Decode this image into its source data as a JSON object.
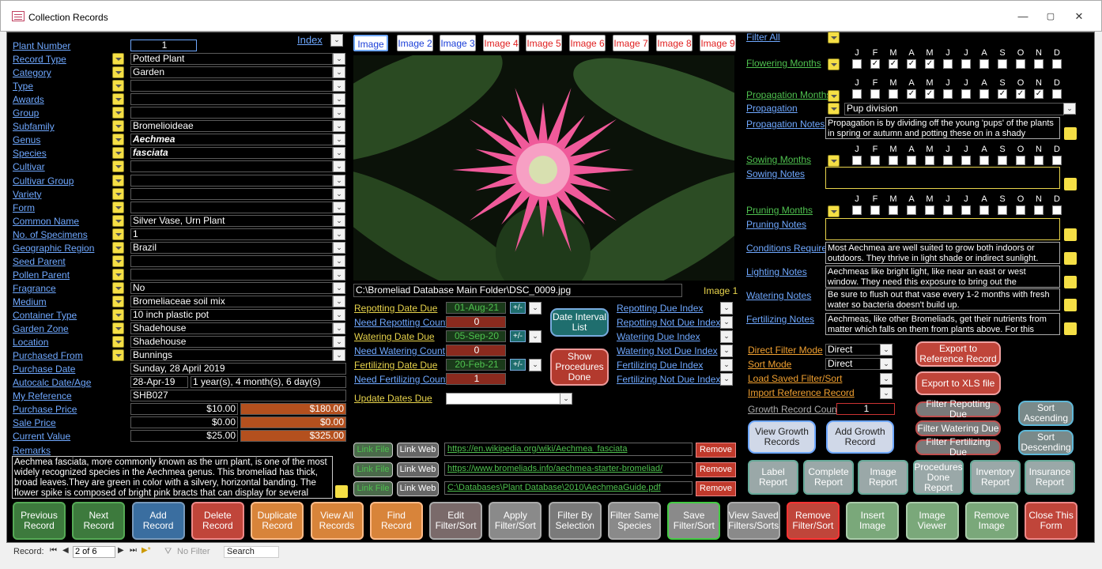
{
  "window": {
    "title": "Collection Records",
    "min": "—",
    "max": "▢",
    "close": "✕"
  },
  "index_label": "Index",
  "fields": [
    {
      "label": "Plant Number",
      "value": "1",
      "kind": "num"
    },
    {
      "label": "Record Type",
      "value": "Potted Plant"
    },
    {
      "label": "Category",
      "value": "Garden"
    },
    {
      "label": "Type",
      "value": ""
    },
    {
      "label": "Awards",
      "value": ""
    },
    {
      "label": "Group",
      "value": ""
    },
    {
      "label": "Subfamily",
      "value": "Bromelioideae"
    },
    {
      "label": "Genus",
      "value": "Aechmea",
      "italic": true
    },
    {
      "label": "Species",
      "value": "fasciata",
      "italic": true
    },
    {
      "label": "Cultivar",
      "value": ""
    },
    {
      "label": "Cultivar Group",
      "value": ""
    },
    {
      "label": "Variety",
      "value": ""
    },
    {
      "label": "Form",
      "value": ""
    },
    {
      "label": "Common Name",
      "value": "Silver Vase, Urn Plant"
    },
    {
      "label": "No. of Specimens",
      "value": "1"
    },
    {
      "label": "Geographic Region",
      "value": "Brazil"
    },
    {
      "label": "Seed Parent",
      "value": ""
    },
    {
      "label": "Pollen Parent",
      "value": ""
    },
    {
      "label": "Fragrance",
      "value": "No"
    },
    {
      "label": "Medium",
      "value": "Bromeliaceae soil mix"
    },
    {
      "label": "Container Type",
      "value": "10 inch plastic pot"
    },
    {
      "label": "Garden Zone",
      "value": "Shadehouse"
    },
    {
      "label": "Location",
      "value": "Shadehouse"
    },
    {
      "label": "Purchased From",
      "value": "Bunnings"
    }
  ],
  "purchase_date": {
    "label": "Purchase Date",
    "value": "Sunday, 28 April 2019"
  },
  "autocalc": {
    "label": "Autocalc Date/Age",
    "date": "28-Apr-19",
    "age": "1 year(s), 4 month(s), 6 day(s)"
  },
  "my_reference": {
    "label": "My Reference",
    "value": "SHB027"
  },
  "prices": [
    {
      "label": "Purchase Price",
      "value": "$10.00",
      "total": "$180.00"
    },
    {
      "label": "Sale Price",
      "value": "$0.00",
      "total": "$0.00"
    },
    {
      "label": "Current Value",
      "value": "$25.00",
      "total": "$325.00"
    }
  ],
  "remarks": {
    "label": "Remarks",
    "text": "Aechmea fasciata, more commonly known as the urn plant, is one of the most widely recognized species in the Aechmea genus. This bromeliad has thick, broad leaves.They are green in color with a silvery, horizontal banding. The flower spike is composed of bright pink bracts that can display for several"
  },
  "image_tabs": [
    "Image 1",
    "Image 2",
    "Image 3",
    "Image 4",
    "Image 5",
    "Image 6",
    "Image 7",
    "Image 8",
    "Image 9"
  ],
  "image_path": "C:\\Bromeliad Database Main Folder\\DSC_0009.jpg",
  "image_caption": "Image 1",
  "dates": [
    {
      "label": "Repotting Date Due",
      "value": "01-Aug-21",
      "count_label": "Need Repotting Count",
      "count": "0"
    },
    {
      "label": "Watering Date Due",
      "value": "05-Sep-20",
      "count_label": "Need Watering Count",
      "count": "0"
    },
    {
      "label": "Fertilizing Date Due",
      "value": "20-Feb-21",
      "count_label": "Need Fertilizing Count",
      "count": "1"
    }
  ],
  "plusminus": "+/-",
  "date_interval_btn": "Date Interval List",
  "show_procedures_btn": "Show Procedures Done",
  "index_links": [
    "Repotting Due Index",
    "Repotting Not Due Index",
    "Watering Due Index",
    "Watering Not Due Index",
    "Fertilizing Due Index",
    "Fertilizing Not Due Index"
  ],
  "update_dates": {
    "label": "Update Dates Due",
    "value": ""
  },
  "links": [
    {
      "file": "Link File",
      "web": "Link Web",
      "url": "https://en.wikipedia.org/wiki/Aechmea_fasciata",
      "remove": "Remove"
    },
    {
      "file": "Link File",
      "web": "Link Web",
      "url": "https://www.bromeliads.info/aechmea-starter-bromeliad/",
      "remove": "Remove"
    },
    {
      "file": "Link File",
      "web": "Link Web",
      "url": "C:\\Databases\\Plant Database\\2010\\AechmeaGuide.pdf",
      "remove": "Remove"
    }
  ],
  "filter_all": "Filter All",
  "months": [
    "J",
    "F",
    "M",
    "A",
    "M",
    "J",
    "J",
    "A",
    "S",
    "O",
    "N",
    "D"
  ],
  "flowering": {
    "label": "Flowering Months",
    "checked": [
      false,
      true,
      true,
      true,
      true,
      false,
      false,
      false,
      false,
      false,
      false,
      false
    ]
  },
  "propagation_months": {
    "label": "Propagation Months",
    "checked": [
      false,
      false,
      false,
      true,
      true,
      false,
      false,
      false,
      true,
      true,
      true,
      false
    ]
  },
  "propagation": {
    "label": "Propagation",
    "value": "Pup division"
  },
  "propagation_notes": {
    "label": "Propagation Notes",
    "text": "Propagation is by dividing off the young 'pups' of the plants in spring or autumn and potting these on in a shady"
  },
  "sowing_months": {
    "label": "Sowing Months",
    "checked": [
      false,
      false,
      false,
      false,
      false,
      false,
      false,
      false,
      false,
      false,
      false,
      false
    ]
  },
  "sowing_notes": {
    "label": "Sowing Notes",
    "text": ""
  },
  "pruning_months": {
    "label": "Pruning Months",
    "checked": [
      false,
      false,
      false,
      false,
      false,
      false,
      false,
      false,
      false,
      false,
      false,
      false
    ]
  },
  "pruning_notes": {
    "label": "Pruning Notes",
    "text": ""
  },
  "conditions": {
    "label": "Conditions Required",
    "text": "Most Aechmea are well suited to grow both indoors or outdoors. They thrive in light shade or indirect sunlight."
  },
  "lighting": {
    "label": "Lighting Notes",
    "text": "Aechmeas like bright light, like near an east or west window. They need this exposure to bring out the"
  },
  "watering": {
    "label": "Watering Notes",
    "text": "Be sure to flush out that vase every 1-2 months with fresh water so bacteria doesn't build up."
  },
  "fertilizing": {
    "label": "Fertilizing Notes",
    "text": "Aechmeas, like other Bromeliads, get their nutrients from matter which falls on them from plants above. For this"
  },
  "direct_filter": {
    "label": "Direct Filter Mode",
    "value": "Direct"
  },
  "sort_mode": {
    "label": "Sort Mode",
    "value": "Direct"
  },
  "load_saved": "Load Saved Filter/Sort",
  "import_ref": "Import Reference Record",
  "export_ref": "Export to Reference Record",
  "export_xls": "Export to XLS file",
  "growth_count": {
    "label": "Growth Record Count",
    "value": "1"
  },
  "view_growth": "View Growth Records",
  "add_growth": "Add Growth Record",
  "filter_due": [
    "Filter Repotting Due",
    "Filter Watering Due",
    "Filter Fertilizing Due"
  ],
  "sort_asc": "Sort Ascending",
  "sort_desc": "Sort Descending",
  "reports": [
    "Label Report",
    "Complete Report",
    "Image Report",
    "Procedures Done Report",
    "Inventory Report",
    "Insurance Report"
  ],
  "bottom_buttons": [
    "Previous Record",
    "Next Record",
    "Add Record",
    "Delete Record",
    "Duplicate Record",
    "View All Records",
    "Find Record",
    "Edit Filter/Sort",
    "Apply Filter/Sort",
    "Filter By Selection",
    "Filter Same Species",
    "Save Filter/Sort",
    "View Saved Filters/Sorts",
    "Remove Filter/Sort",
    "Insert Image",
    "Image Viewer",
    "Remove Image",
    "Close This Form"
  ],
  "status": {
    "record_label": "Record:",
    "position": "2 of 6",
    "no_filter": "No Filter",
    "search": "Search"
  }
}
